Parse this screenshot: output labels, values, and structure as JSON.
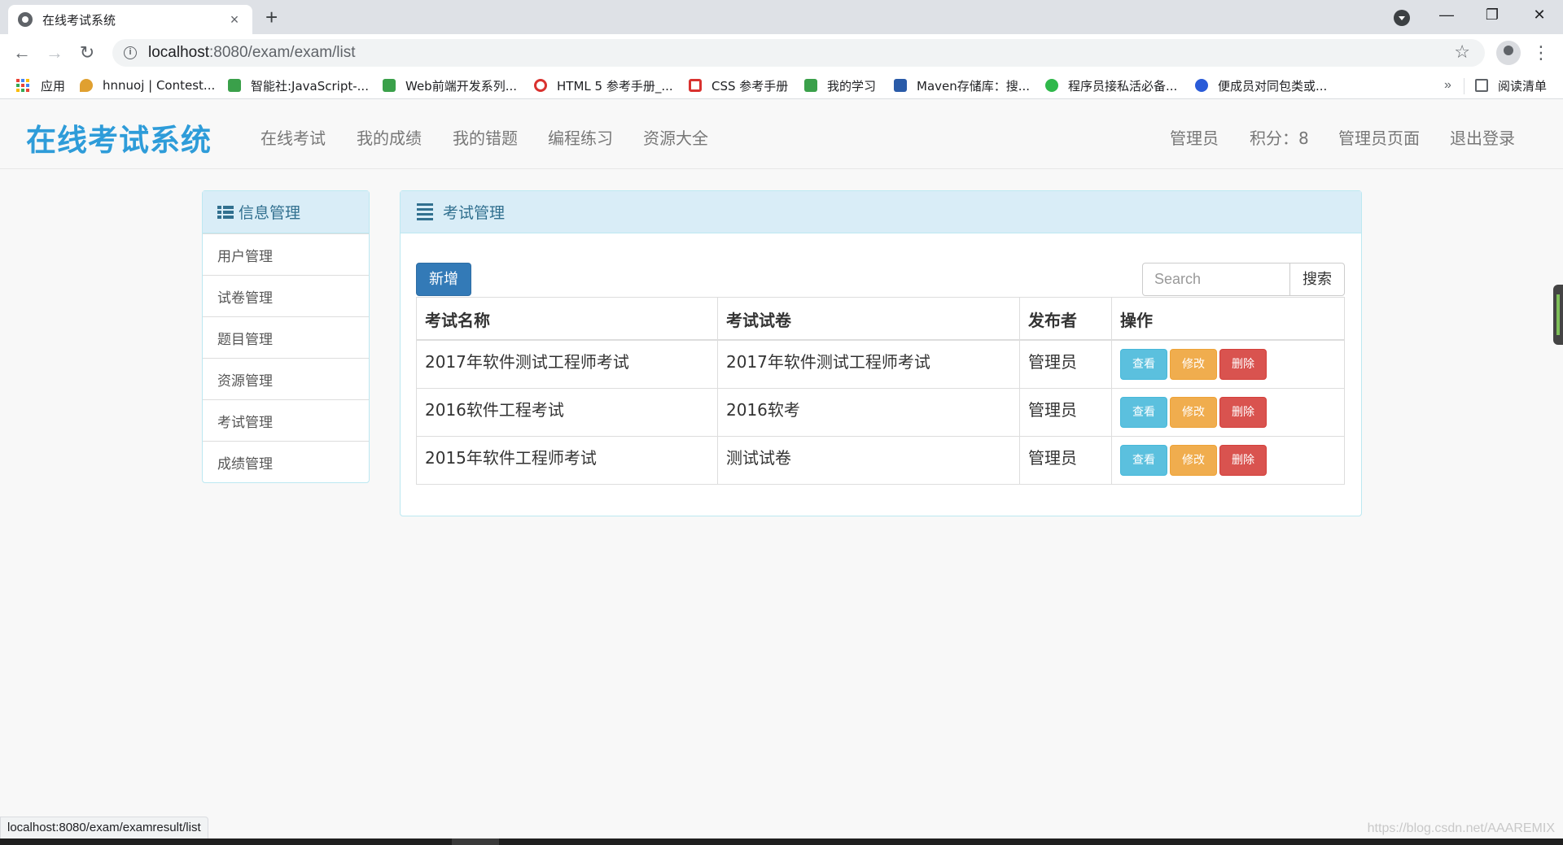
{
  "browser": {
    "tab_title": "在线考试系统",
    "tab_close": "×",
    "new_tab": "+",
    "url_host": "localhost",
    "url_rest": ":8080/exam/exam/list",
    "window_controls": [
      "—",
      "❐",
      "✕"
    ],
    "icons": [
      "back-icon",
      "forward-icon",
      "reload-icon",
      "info-icon",
      "star-icon",
      "profile-icon",
      "menu-icon"
    ],
    "nav_glyphs": {
      "back": "←",
      "forward": "→",
      "reload": "↻",
      "info": "i",
      "star": "☆",
      "menu": "⋮"
    }
  },
  "bookmarks": {
    "items": [
      {
        "label": "应用",
        "icon": "apps-icon"
      },
      {
        "label": "hnnuoj | Contest...",
        "icon": "pin-icon",
        "color": "#e0a030"
      },
      {
        "label": "智能社:JavaScript-...",
        "icon": "book-icon",
        "color": "#3aa04a"
      },
      {
        "label": "Web前端开发系列...",
        "icon": "book-icon",
        "color": "#3aa04a"
      },
      {
        "label": "HTML 5 参考手册_...",
        "icon": "owl-icon",
        "color": "#d9322f"
      },
      {
        "label": "CSS 参考手册",
        "icon": "css-icon",
        "color": "#d9322f"
      },
      {
        "label": "我的学习",
        "icon": "book-icon",
        "color": "#3aa04a"
      },
      {
        "label": "Maven存储库：搜...",
        "icon": "mvn-icon",
        "color": "#2a5ba8"
      },
      {
        "label": "程序员接私活必备...",
        "icon": "wechat-icon",
        "color": "#2fb84a"
      },
      {
        "label": "便成员对同包类或...",
        "icon": "paw-icon",
        "color": "#2a5bd8"
      }
    ],
    "more": "»",
    "reading_list": "阅读清单"
  },
  "app_nav": {
    "brand": "在线考试系统",
    "left": [
      "在线考试",
      "我的成绩",
      "我的错题",
      "编程练习",
      "资源大全"
    ],
    "user": "管理员",
    "points": "积分：8",
    "admin_page": "管理员页面",
    "logout": "退出登录"
  },
  "sidebar": {
    "title": "信息管理",
    "items": [
      "用户管理",
      "试卷管理",
      "题目管理",
      "资源管理",
      "考试管理",
      "成绩管理"
    ]
  },
  "main": {
    "title": "考试管理",
    "add_label": "新增",
    "search_placeholder": "Search",
    "search_label": "搜索",
    "columns": [
      "考试名称",
      "考试试卷",
      "发布者",
      "操作"
    ],
    "rows": [
      {
        "name": "2017年软件测试工程师考试",
        "paper": "2017年软件测试工程师考试",
        "publisher": "管理员"
      },
      {
        "name": "2016软件工程考试",
        "paper": "2016软考",
        "publisher": "管理员"
      },
      {
        "name": "2015年软件工程师考试",
        "paper": "测试试卷",
        "publisher": "管理员"
      }
    ],
    "actions": {
      "view": "查看",
      "edit": "修改",
      "delete": "删除"
    }
  },
  "status_bar_url": "localhost:8080/exam/examresult/list",
  "watermark": "https://blog.csdn.net/AAAREMIX"
}
